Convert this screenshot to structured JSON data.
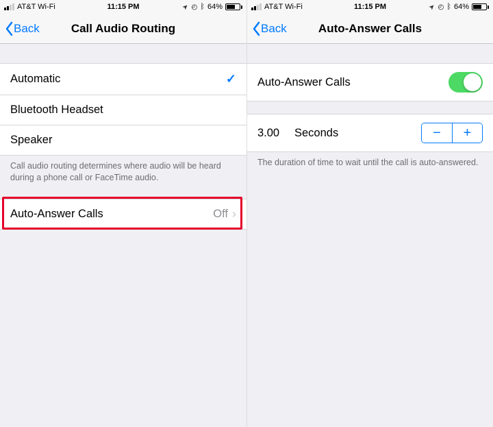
{
  "status": {
    "carrier": "AT&T Wi-Fi",
    "time": "11:15 PM",
    "battery_pct": "64%",
    "battery_fill_pct": 64
  },
  "left": {
    "back_label": "Back",
    "title": "Call Audio Routing",
    "options": [
      {
        "label": "Automatic",
        "selected": true
      },
      {
        "label": "Bluetooth Headset",
        "selected": false
      },
      {
        "label": "Speaker",
        "selected": false
      }
    ],
    "options_footer": "Call audio routing determines where audio will be heard during a phone call or FaceTime audio.",
    "auto_answer": {
      "label": "Auto-Answer Calls",
      "value": "Off"
    }
  },
  "right": {
    "back_label": "Back",
    "title": "Auto-Answer Calls",
    "toggle": {
      "label": "Auto-Answer Calls",
      "on": true
    },
    "duration": {
      "value": "3.00",
      "unit": "Seconds"
    },
    "duration_footer": "The duration of time to wait until the call is auto-answered."
  },
  "glyphs": {
    "checkmark": "✓",
    "chevron": "›",
    "location": "➤",
    "alarm": "⏰",
    "bluetooth": "✱",
    "minus": "−",
    "plus": "+"
  }
}
